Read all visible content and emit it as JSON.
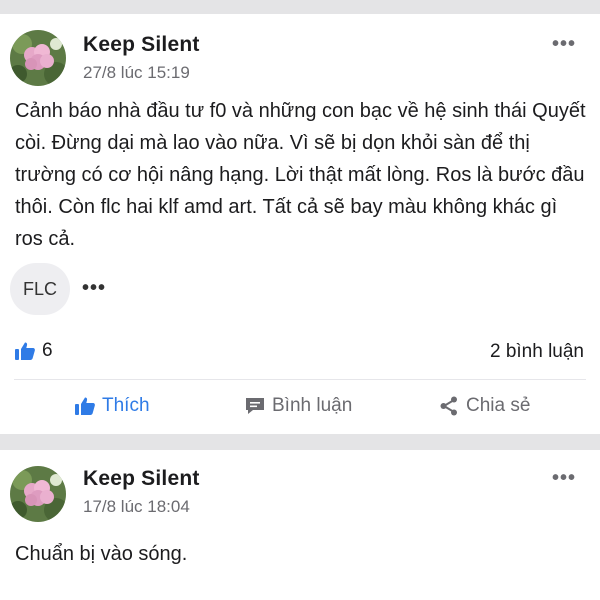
{
  "posts": [
    {
      "author": "Keep Silent",
      "time": "27/8 lúc 15:19",
      "text": "Cảnh báo nhà đầu tư f0 và những con bạc về hệ sinh thái Quyết còi. Đừng dại mà lao vào nữa. Vì sẽ bị dọn khỏi sàn để thị trường có cơ hội nâng hạng. Lời thật mất lòng. Ros là bước đầu thôi. Còn flc hai klf amd art. Tất cả sẽ bay màu không khác gì ros cả.",
      "tag": "FLC",
      "likes": "6",
      "comments": "2 bình luận"
    },
    {
      "author": "Keep Silent",
      "time": "17/8 lúc 18:04",
      "text": "Chuẩn bị vào sóng."
    }
  ],
  "actions": {
    "like": "Thích",
    "comment": "Bình luận",
    "share": "Chia sẻ"
  },
  "icons": {
    "more": "more-horizontal-icon",
    "like": "thumbs-up-icon",
    "comment": "comment-bubble-icon",
    "share": "share-icon"
  },
  "colors": {
    "accent": "#2f7be6",
    "muted": "#6b6b70",
    "separator": "#e4e4e6"
  }
}
